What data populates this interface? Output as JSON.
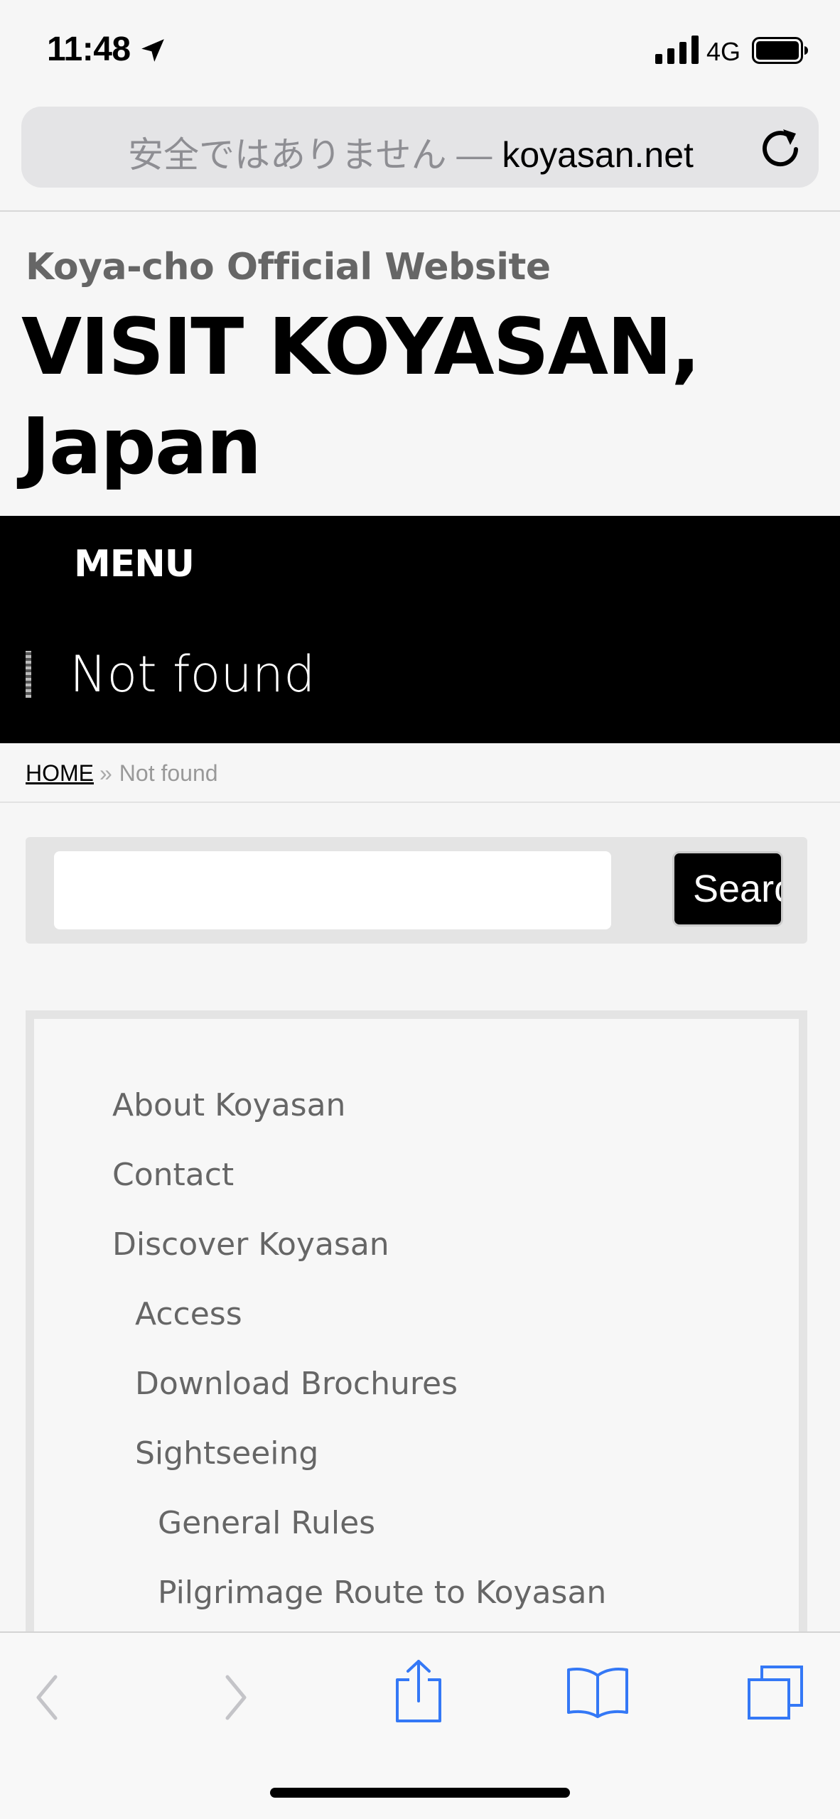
{
  "status_bar": {
    "time": "11:48",
    "network": "4G"
  },
  "address_bar": {
    "security_note": "安全ではありません —",
    "domain": "koyasan.net"
  },
  "site": {
    "subtitle": "Koya-cho Official Website",
    "title": "VISIT KOYASAN, Japan"
  },
  "menu": {
    "label": "MENU"
  },
  "page": {
    "heading": "Not found"
  },
  "breadcrumb": {
    "home": "HOME",
    "separator": "»",
    "current": "Not found"
  },
  "search": {
    "input_value": "",
    "button_label": "Search"
  },
  "nav_items": [
    {
      "label": "About Koyasan",
      "level": 0
    },
    {
      "label": "Contact",
      "level": 0
    },
    {
      "label": "Discover Koyasan",
      "level": 0
    },
    {
      "label": "Access",
      "level": 1
    },
    {
      "label": "Download Brochures",
      "level": 1
    },
    {
      "label": "Sightseeing",
      "level": 1
    },
    {
      "label": "General Rules",
      "level": 2
    },
    {
      "label": "Pilgrimage Route to Koyasan",
      "level": 2
    }
  ],
  "toolbar": {
    "icons": [
      "back-icon",
      "forward-icon",
      "share-icon",
      "bookmarks-icon",
      "tabs-icon"
    ]
  },
  "colors": {
    "accent": "#3478f6",
    "disabled": "#c4c4c8",
    "band": "#000000"
  }
}
